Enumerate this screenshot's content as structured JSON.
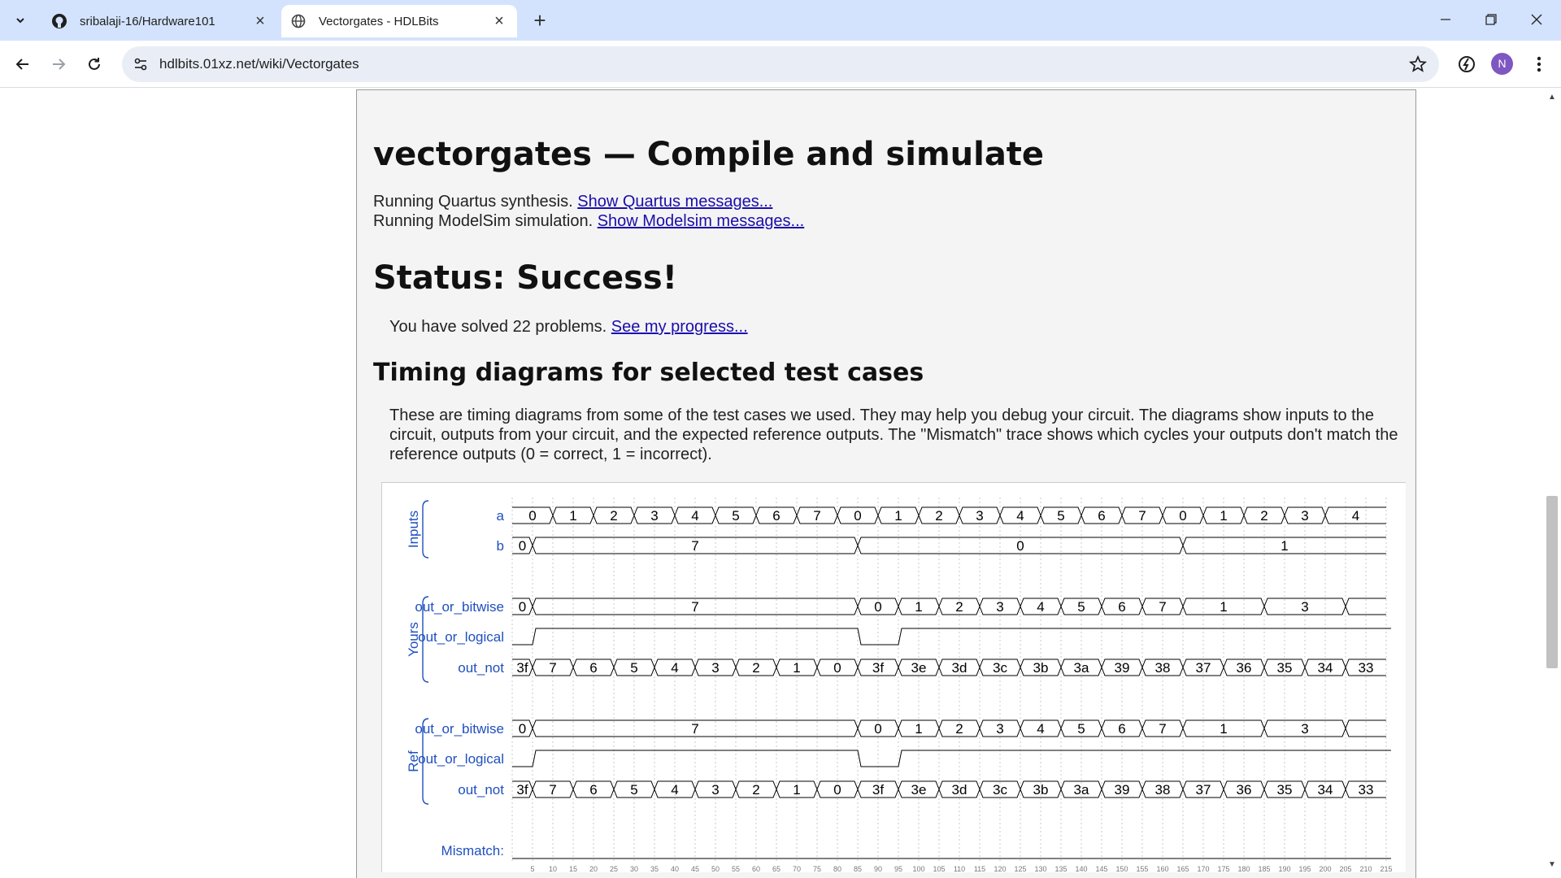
{
  "browser": {
    "tabs": [
      {
        "title": "sribalaji-16/Hardware101",
        "icon": "github-icon",
        "active": false
      },
      {
        "title": "Vectorgates - HDLBits",
        "icon": "globe-icon",
        "active": true
      }
    ],
    "url": "hdlbits.01xz.net/wiki/Vectorgates",
    "avatar_letter": "N",
    "avatar_color": "#7e57c2"
  },
  "page": {
    "title": "vectorgates — Compile and simulate",
    "quartus": {
      "text": "Running Quartus synthesis. ",
      "link": "Show Quartus messages..."
    },
    "modelsim": {
      "text": "Running ModelSim simulation. ",
      "link": "Show Modelsim messages..."
    },
    "status": "Status: Success!",
    "solved": {
      "text": "You have solved 22 problems. ",
      "link": "See my progress..."
    },
    "timing_heading": "Timing diagrams for selected test cases",
    "description": "These are timing diagrams from some of the test cases we used. They may help you debug your circuit. The diagrams show inputs to the circuit, outputs from your circuit, and the expected reference outputs. The \"Mismatch\" trace shows which cycles your outputs don't match the reference outputs (0 = correct, 1 = incorrect)."
  },
  "timing": {
    "groups": [
      {
        "label": "Inputs",
        "signals": [
          "a",
          "b"
        ]
      },
      {
        "label": "Yours",
        "signals": [
          "out_or_bitwise",
          "out_or_logical",
          "out_not"
        ]
      },
      {
        "label": "Ref",
        "signals": [
          "out_or_bitwise",
          "out_or_logical",
          "out_not"
        ]
      }
    ],
    "mismatch_label": "Mismatch:",
    "time_ticks": [
      "5",
      "10",
      "15",
      "20",
      "25",
      "30",
      "35",
      "40",
      "45",
      "50",
      "55",
      "60",
      "65",
      "70",
      "75",
      "80",
      "85",
      "90",
      "95",
      "100",
      "105",
      "110",
      "115",
      "120",
      "125",
      "130",
      "135",
      "140",
      "145",
      "150",
      "155",
      "160",
      "165",
      "170",
      "175",
      "180",
      "185",
      "190",
      "195",
      "200",
      "205",
      "210",
      "215"
    ],
    "traces": {
      "a": [
        [
          "0",
          0,
          10
        ],
        [
          "1",
          10,
          20
        ],
        [
          "2",
          20,
          30
        ],
        [
          "3",
          30,
          40
        ],
        [
          "4",
          40,
          50
        ],
        [
          "5",
          50,
          60
        ],
        [
          "6",
          60,
          70
        ],
        [
          "7",
          70,
          80
        ],
        [
          "0",
          80,
          90
        ],
        [
          "1",
          90,
          100
        ],
        [
          "2",
          100,
          110
        ],
        [
          "3",
          110,
          120
        ],
        [
          "4",
          120,
          130
        ],
        [
          "5",
          130,
          140
        ],
        [
          "6",
          140,
          150
        ],
        [
          "7",
          150,
          160
        ],
        [
          "0",
          160,
          170
        ],
        [
          "1",
          170,
          180
        ],
        [
          "2",
          180,
          190
        ],
        [
          "3",
          190,
          200
        ],
        [
          "4",
          200,
          215
        ]
      ],
      "b": [
        [
          "0",
          0,
          5
        ],
        [
          "7",
          5,
          85
        ],
        [
          "0",
          85,
          165
        ],
        [
          "1",
          165,
          215
        ]
      ],
      "yours_out_or_bitwise": [
        [
          "0",
          0,
          5
        ],
        [
          "7",
          5,
          85
        ],
        [
          "0",
          85,
          95
        ],
        [
          "1",
          95,
          105
        ],
        [
          "2",
          105,
          115
        ],
        [
          "3",
          115,
          125
        ],
        [
          "4",
          125,
          135
        ],
        [
          "5",
          135,
          145
        ],
        [
          "6",
          145,
          155
        ],
        [
          "7",
          155,
          165
        ],
        [
          "1",
          165,
          185
        ],
        [
          "3",
          185,
          205
        ],
        [
          "",
          205,
          215
        ]
      ],
      "yours_out_or_logical": [
        [
          0,
          0,
          5
        ],
        [
          1,
          5,
          85
        ],
        [
          0,
          85,
          95
        ],
        [
          1,
          95,
          215
        ]
      ],
      "yours_out_not": [
        [
          "3f",
          0,
          5
        ],
        [
          "7",
          5,
          15
        ],
        [
          "6",
          15,
          25
        ],
        [
          "5",
          25,
          35
        ],
        [
          "4",
          35,
          45
        ],
        [
          "3",
          45,
          55
        ],
        [
          "2",
          55,
          65
        ],
        [
          "1",
          65,
          75
        ],
        [
          "0",
          75,
          85
        ],
        [
          "3f",
          85,
          95
        ],
        [
          "3e",
          95,
          105
        ],
        [
          "3d",
          105,
          115
        ],
        [
          "3c",
          115,
          125
        ],
        [
          "3b",
          125,
          135
        ],
        [
          "3a",
          135,
          145
        ],
        [
          "39",
          145,
          155
        ],
        [
          "38",
          155,
          165
        ],
        [
          "37",
          165,
          175
        ],
        [
          "36",
          175,
          185
        ],
        [
          "35",
          185,
          195
        ],
        [
          "34",
          195,
          205
        ],
        [
          "33",
          205,
          215
        ]
      ],
      "ref_out_or_bitwise": [
        [
          "0",
          0,
          5
        ],
        [
          "7",
          5,
          85
        ],
        [
          "0",
          85,
          95
        ],
        [
          "1",
          95,
          105
        ],
        [
          "2",
          105,
          115
        ],
        [
          "3",
          115,
          125
        ],
        [
          "4",
          125,
          135
        ],
        [
          "5",
          135,
          145
        ],
        [
          "6",
          145,
          155
        ],
        [
          "7",
          155,
          165
        ],
        [
          "1",
          165,
          185
        ],
        [
          "3",
          185,
          205
        ],
        [
          "",
          205,
          215
        ]
      ],
      "ref_out_or_logical": [
        [
          0,
          0,
          5
        ],
        [
          1,
          5,
          85
        ],
        [
          0,
          85,
          95
        ],
        [
          1,
          95,
          215
        ]
      ],
      "ref_out_not": [
        [
          "3f",
          0,
          5
        ],
        [
          "7",
          5,
          15
        ],
        [
          "6",
          15,
          25
        ],
        [
          "5",
          25,
          35
        ],
        [
          "4",
          35,
          45
        ],
        [
          "3",
          45,
          55
        ],
        [
          "2",
          55,
          65
        ],
        [
          "1",
          65,
          75
        ],
        [
          "0",
          75,
          85
        ],
        [
          "3f",
          85,
          95
        ],
        [
          "3e",
          95,
          105
        ],
        [
          "3d",
          105,
          115
        ],
        [
          "3c",
          115,
          125
        ],
        [
          "3b",
          125,
          135
        ],
        [
          "3a",
          135,
          145
        ],
        [
          "39",
          145,
          155
        ],
        [
          "38",
          155,
          165
        ],
        [
          "37",
          165,
          175
        ],
        [
          "36",
          175,
          185
        ],
        [
          "35",
          185,
          195
        ],
        [
          "34",
          195,
          205
        ],
        [
          "33",
          205,
          215
        ]
      ],
      "mismatch": [
        [
          0,
          0,
          215
        ]
      ]
    },
    "colors": {
      "label": "#1f4fbf",
      "trace": "#000000",
      "grid": "#bbbbbb"
    }
  }
}
